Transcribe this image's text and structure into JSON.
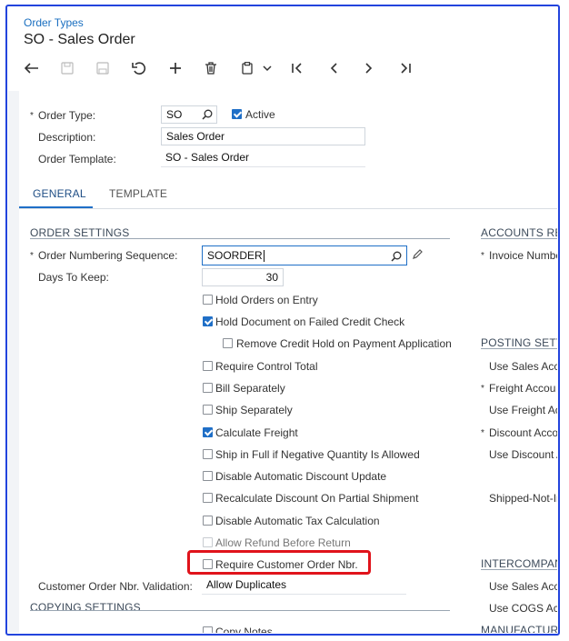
{
  "header": {
    "breadcrumb": "Order Types",
    "title": "SO - Sales Order"
  },
  "toolbar": {
    "icons": [
      "back-arrow-icon",
      "save-close-icon",
      "save-icon",
      "undo-icon",
      "add-icon",
      "delete-icon",
      "copy-paste-icon",
      "chevron-down-icon",
      "first-record-icon",
      "previous-record-icon",
      "next-record-icon",
      "last-record-icon"
    ]
  },
  "form": {
    "order_type_label": "Order Type:",
    "order_type_value": "SO",
    "active_label": "Active",
    "active_checked": true,
    "description_label": "Description:",
    "description_value": "Sales Order",
    "order_template_label": "Order Template:",
    "order_template_value": "SO - Sales Order"
  },
  "tabs": [
    {
      "label": "GENERAL",
      "active": true
    },
    {
      "label": "TEMPLATE",
      "active": false
    }
  ],
  "order_settings": {
    "heading": "ORDER SETTINGS",
    "numbering_label": "Order Numbering Sequence:",
    "numbering_value": "SOORDER",
    "days_label": "Days To Keep:",
    "days_value": "30",
    "checkboxes": [
      {
        "label": "Hold Orders on Entry",
        "checked": false
      },
      {
        "label": "Hold Document on Failed Credit Check",
        "checked": true
      },
      {
        "label": "Remove Credit Hold on Payment Application",
        "checked": false
      },
      {
        "label": "Require Control Total",
        "checked": false
      },
      {
        "label": "Bill Separately",
        "checked": false
      },
      {
        "label": "Ship Separately",
        "checked": false
      },
      {
        "label": "Calculate Freight",
        "checked": true
      },
      {
        "label": "Ship in Full if Negative Quantity Is Allowed",
        "checked": false
      },
      {
        "label": "Disable Automatic Discount Update",
        "checked": false
      },
      {
        "label": "Recalculate Discount On Partial Shipment",
        "checked": false
      },
      {
        "label": "Disable Automatic Tax Calculation",
        "checked": false
      },
      {
        "label": "Allow Refund Before Return",
        "checked": false,
        "disabled": true
      },
      {
        "label": "Require Customer Order Nbr.",
        "checked": false
      }
    ],
    "cust_order_validation_label": "Customer Order Nbr. Validation:",
    "cust_order_validation_value": "Allow Duplicates"
  },
  "copying_settings": {
    "heading": "COPYING SETTINGS",
    "partial_item": "Copy Notes"
  },
  "right_column": {
    "accounts_heading": "ACCOUNTS RE",
    "invoice_number_label": "Invoice Numbe",
    "posting_heading": "POSTING SETT",
    "use_sales_acc_label": "Use Sales Acc",
    "freight_account_label": "Freight Accou",
    "use_freight_label": "Use Freight Ac",
    "discount_account_label": "Discount Acco",
    "use_discount_label": "Use Discount A",
    "shipped_not_invoiced_label": "Shipped-Not-In",
    "intercompany_heading": "INTERCOMPAN",
    "use_sales_acc2_label": "Use Sales Acc",
    "use_cogs_label": "Use COGS Ac",
    "manufacturing_heading": "MANUFACTURI"
  },
  "colors": {
    "accent": "#1f6fc7",
    "link": "#1a6fc0",
    "highlight": "#e0131b"
  }
}
